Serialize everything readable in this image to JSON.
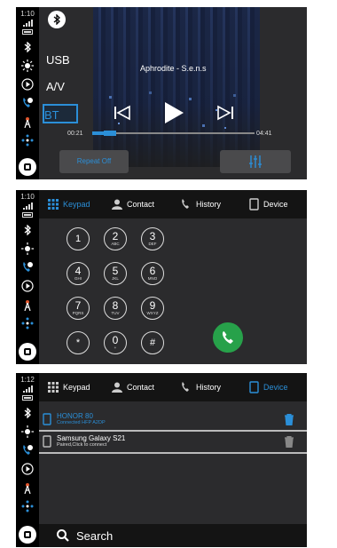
{
  "screens": [
    {
      "status": {
        "time": "1:10"
      },
      "media": {
        "sources": [
          "USB",
          "A/V",
          "BT"
        ],
        "active_source": "BT",
        "track": "Aphrodite - S.e.n.s",
        "current_time": "00:21",
        "total_time": "04:41",
        "progress_fraction": 0.08,
        "repeat_label": "Repeat Off"
      }
    },
    {
      "status": {
        "time": "1:10"
      },
      "tabs": [
        "Keypad",
        "Contact",
        "History",
        "Device"
      ],
      "active_tab": "Keypad",
      "keys": [
        {
          "digit": "1",
          "letters": ""
        },
        {
          "digit": "2",
          "letters": "ABC"
        },
        {
          "digit": "3",
          "letters": "DEF"
        },
        {
          "digit": "4",
          "letters": "GHI"
        },
        {
          "digit": "5",
          "letters": "JKL"
        },
        {
          "digit": "6",
          "letters": "MNO"
        },
        {
          "digit": "7",
          "letters": "PQRS"
        },
        {
          "digit": "8",
          "letters": "TUV"
        },
        {
          "digit": "9",
          "letters": "WXYZ"
        },
        {
          "digit": "*",
          "letters": ""
        },
        {
          "digit": "0",
          "letters": "+"
        },
        {
          "digit": "#",
          "letters": ""
        }
      ]
    },
    {
      "status": {
        "time": "1:12"
      },
      "tabs": [
        "Keypad",
        "Contact",
        "History",
        "Device"
      ],
      "active_tab": "Device",
      "devices": [
        {
          "name": "HONOR 80",
          "status": "Connected HFP A2DP"
        },
        {
          "name": "Samsung Galaxy S21",
          "status": "Paired,Click to connect"
        }
      ],
      "search_label": "Search"
    }
  ],
  "colors": {
    "accent": "#2b8fd8",
    "call_green": "#27a14a",
    "background": "#2b2b2d"
  }
}
